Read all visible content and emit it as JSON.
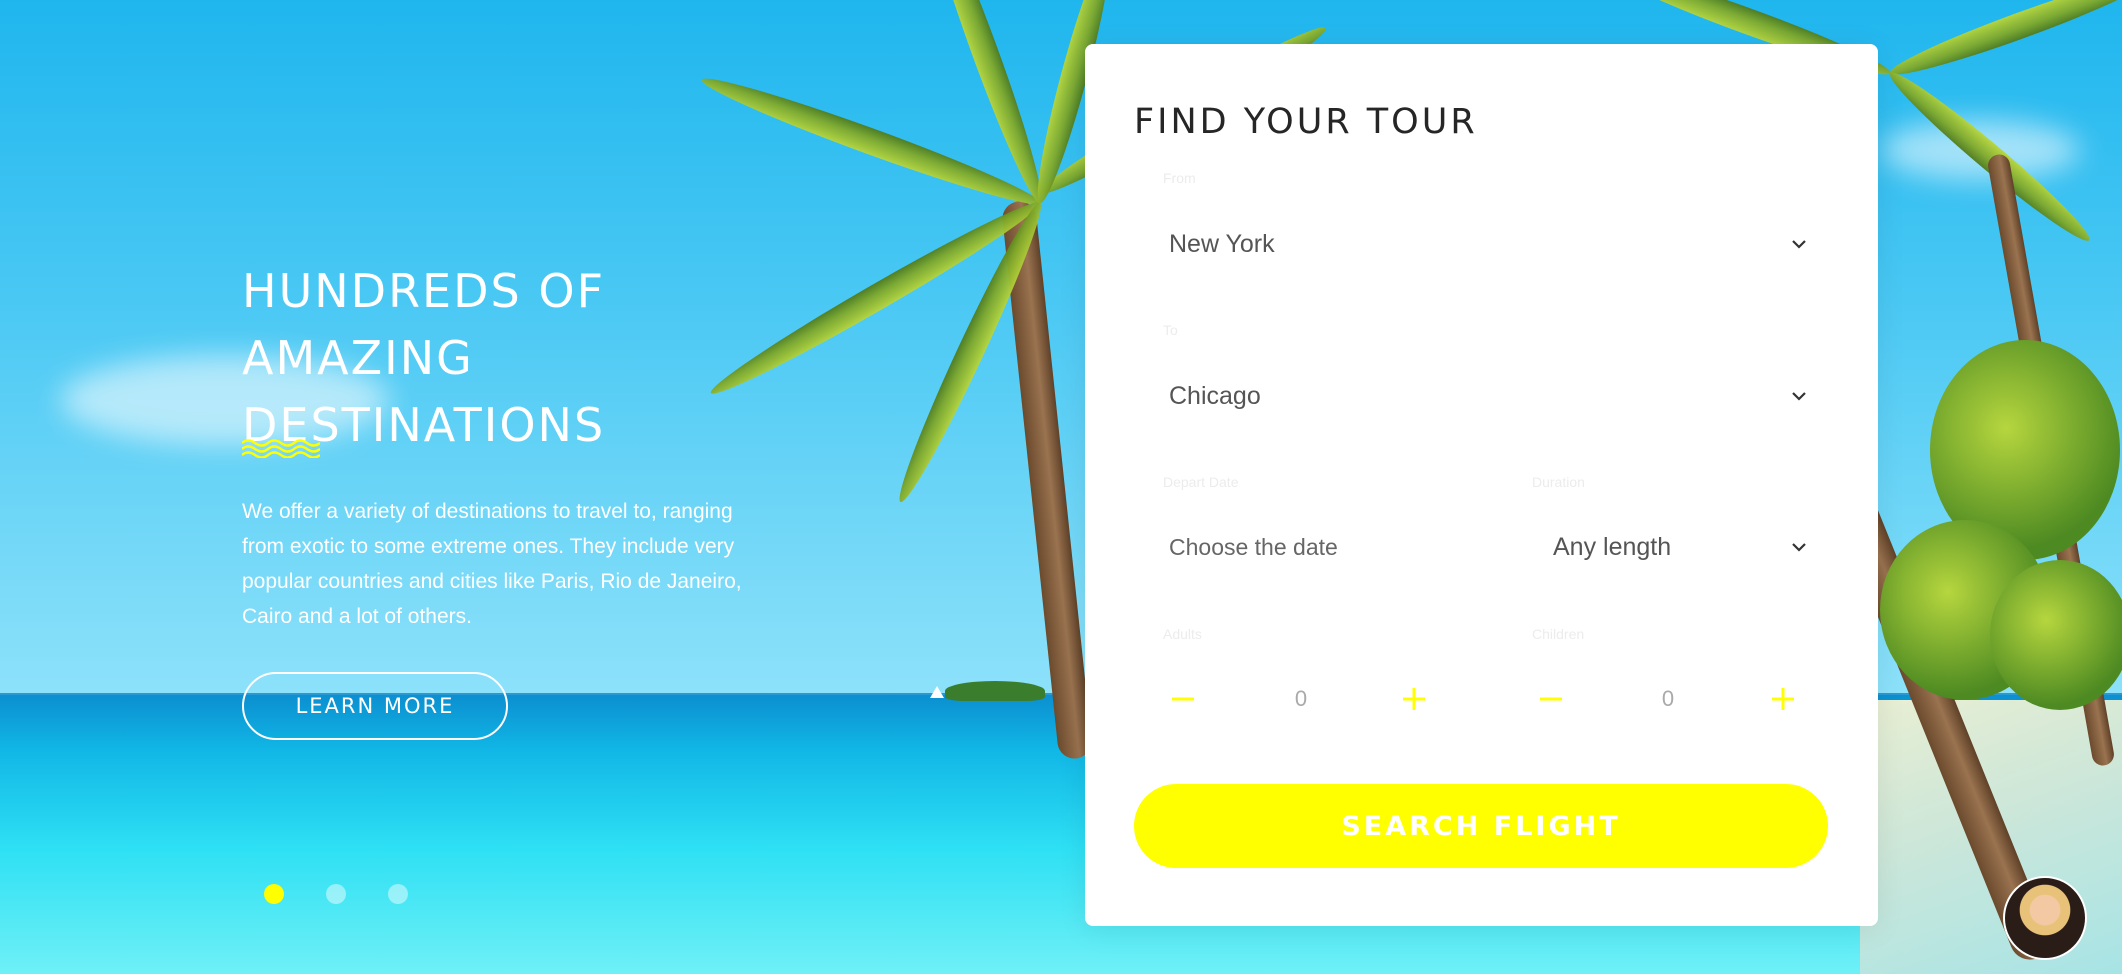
{
  "hero": {
    "title_line1": "HUNDREDS OF AMAZING",
    "title_line2": "DESTINATIONS",
    "description": "We offer a variety of destinations to travel to, ranging from exotic to some extreme ones. They include very popular countries and cities like Paris, Rio de Janeiro, Cairo and a lot of others.",
    "cta_label": "LEARN MORE",
    "accent_color": "#ffff00"
  },
  "slider": {
    "count": 3,
    "active_index": 0
  },
  "search_form": {
    "title": "FIND YOUR TOUR",
    "from": {
      "label": "From",
      "value": "New York"
    },
    "to": {
      "label": "To",
      "value": "Chicago"
    },
    "depart": {
      "label": "Depart Date",
      "placeholder": "Choose the date"
    },
    "duration": {
      "label": "Duration",
      "value": "Any length"
    },
    "adults": {
      "label": "Adults",
      "value": "0"
    },
    "children": {
      "label": "Children",
      "value": "0"
    },
    "submit_label": "SEARCH FLIGHT",
    "button_color": "#ffff00"
  },
  "icons": {
    "dropdown": "chevron-down-icon",
    "decrement": "minus-icon",
    "increment": "plus-icon"
  }
}
